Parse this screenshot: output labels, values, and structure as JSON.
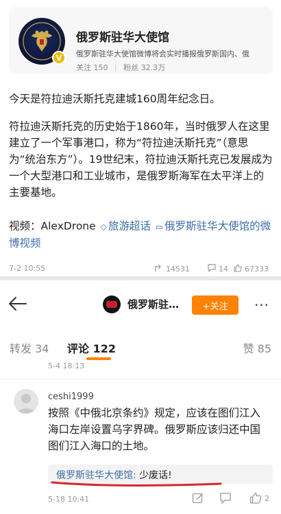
{
  "account": {
    "name": "俄罗斯驻华大使馆",
    "description": "俄罗斯驻华大使馆微博将会实时播报俄罗斯国内、俄",
    "following_label": "关注",
    "following_count": "150",
    "followers_label": "粉丝",
    "followers_count": "32.3万",
    "verified_badge": "V"
  },
  "post": {
    "line1": "今天是符拉迪沃斯托克建城160周年纪念日。",
    "paragraph2": "符拉迪沃斯托克的历史始于1860年，当时俄罗人在这里建立了一个军事港口，称为“符拉迪沃斯托克”（意思为“统治东方”）。19世纪末，符拉迪沃斯托克已发展成为一个大型港口和工业城市，是俄罗斯海军在太平洋上的主要基地。",
    "video_prefix": "视频：",
    "video_author": "AlexDrone",
    "topic_link": "旅游超话",
    "video_link": "俄罗斯驻华大使馆的微博视频",
    "date": "7-2 10:55",
    "shares": "14531",
    "comments": "14",
    "likes": "67333"
  },
  "nav": {
    "title": "俄罗斯驻…",
    "follow_label": "+关注",
    "more_label": "···"
  },
  "tabs": {
    "repost": "转发 34",
    "comment": "评论 122",
    "like": "赞 85"
  },
  "previous_comment": {
    "timestamp": "5-4 18:13"
  },
  "comment": {
    "username": "ceshi1999",
    "text": "按照《中俄北京条约》规定，应该在图们江入海口左岸设置乌字界碑。俄罗斯应该归还中国图们江入海口的土地。",
    "reply_author": "俄罗斯驻华大使馆:",
    "reply_text": " 少废话!",
    "timestamp": "5-18 10:41",
    "likes": "2"
  },
  "colors": {
    "accent_orange": "#ff8200",
    "link_blue": "#3d6ea8",
    "highlight_red": "#d8262e",
    "verify_gold": "#f5b800"
  }
}
